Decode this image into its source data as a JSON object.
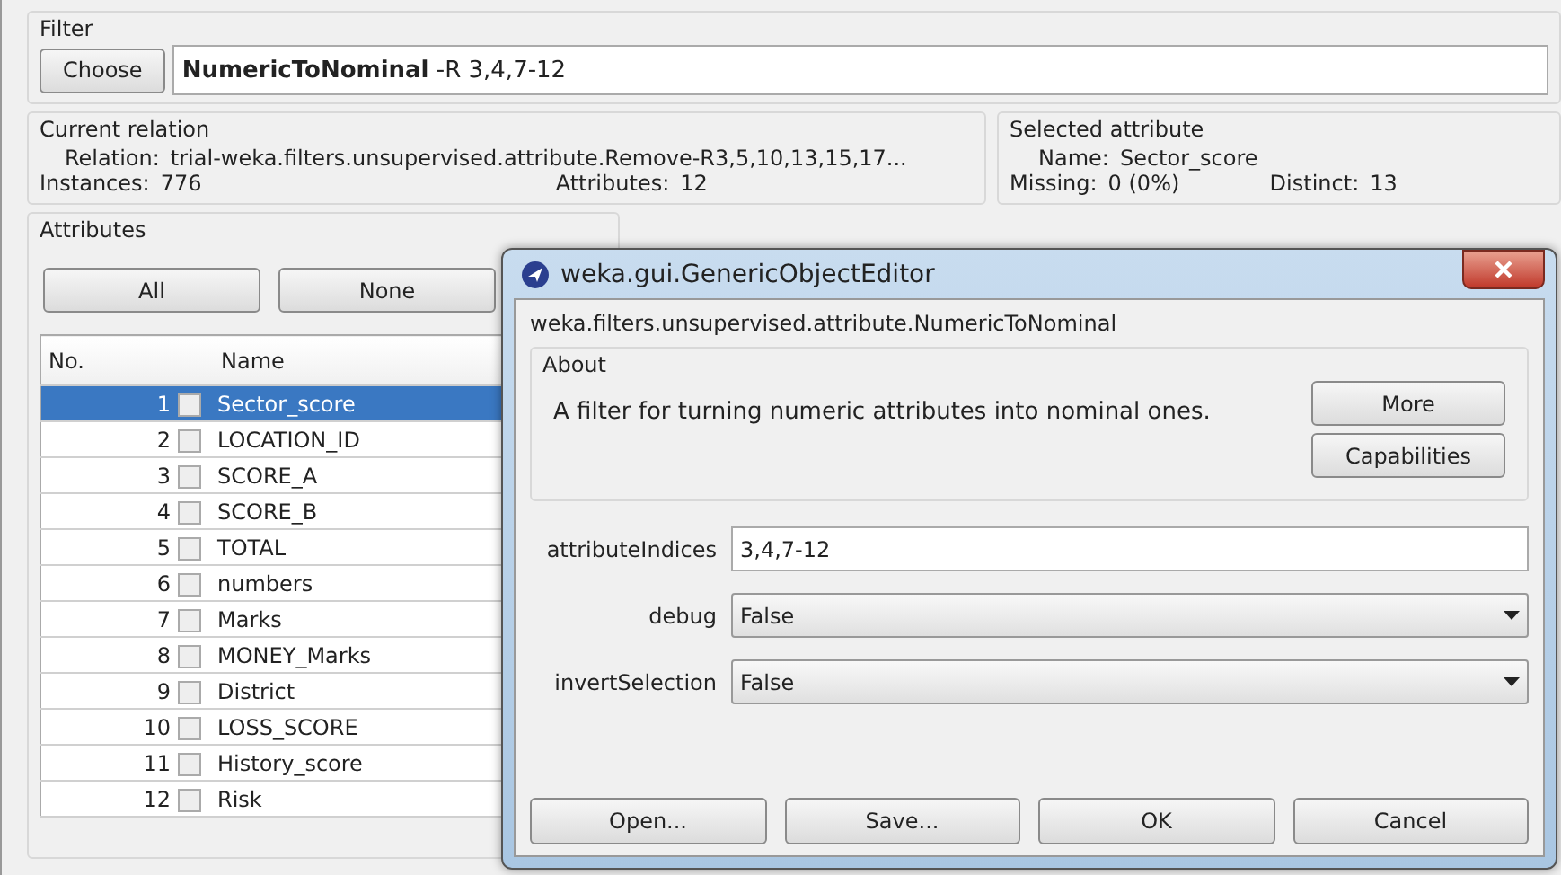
{
  "filter": {
    "title": "Filter",
    "choose_button": "Choose",
    "name": "NumericToNominal",
    "options": "-R 3,4,7-12"
  },
  "current_relation": {
    "title": "Current relation",
    "relation_label": "Relation:",
    "relation": "trial-weka.filters.unsupervised.attribute.Remove-R3,5,10,13,15,17...",
    "instances_label": "Instances:",
    "instances": "776",
    "attributes_label": "Attributes:",
    "attributes": "12"
  },
  "selected_attribute": {
    "title": "Selected attribute",
    "name_label": "Name:",
    "name": "Sector_score",
    "missing_label": "Missing:",
    "missing": "0 (0%)",
    "distinct_label": "Distinct:",
    "distinct": "13"
  },
  "attributes": {
    "title": "Attributes",
    "buttons": [
      "All",
      "None"
    ],
    "columns": [
      "No.",
      "Name"
    ],
    "rows": [
      {
        "no": "1",
        "name": "Sector_score",
        "checked": false,
        "selected": true
      },
      {
        "no": "2",
        "name": "LOCATION_ID",
        "checked": false,
        "selected": false
      },
      {
        "no": "3",
        "name": "SCORE_A",
        "checked": false,
        "selected": false
      },
      {
        "no": "4",
        "name": "SCORE_B",
        "checked": false,
        "selected": false
      },
      {
        "no": "5",
        "name": "TOTAL",
        "checked": false,
        "selected": false
      },
      {
        "no": "6",
        "name": "numbers",
        "checked": false,
        "selected": false
      },
      {
        "no": "7",
        "name": "Marks",
        "checked": false,
        "selected": false
      },
      {
        "no": "8",
        "name": "MONEY_Marks",
        "checked": false,
        "selected": false
      },
      {
        "no": "9",
        "name": "District",
        "checked": false,
        "selected": false
      },
      {
        "no": "10",
        "name": "LOSS_SCORE",
        "checked": false,
        "selected": false
      },
      {
        "no": "11",
        "name": "History_score",
        "checked": false,
        "selected": false
      },
      {
        "no": "12",
        "name": "Risk",
        "checked": false,
        "selected": false
      }
    ]
  },
  "dialog": {
    "title": "weka.gui.GenericObjectEditor",
    "class_name": "weka.filters.unsupervised.attribute.NumericToNominal",
    "about": {
      "title": "About",
      "text": "A filter for turning numeric attributes into nominal ones.",
      "buttons": [
        "More",
        "Capabilities"
      ]
    },
    "properties": [
      {
        "kind": "text",
        "label": "attributeIndices",
        "value": "3,4,7-12"
      },
      {
        "kind": "dropdown",
        "label": "debug",
        "value": "False"
      },
      {
        "kind": "dropdown",
        "label": "invertSelection",
        "value": "False"
      }
    ],
    "buttons": [
      "Open...",
      "Save...",
      "OK",
      "Cancel"
    ]
  }
}
